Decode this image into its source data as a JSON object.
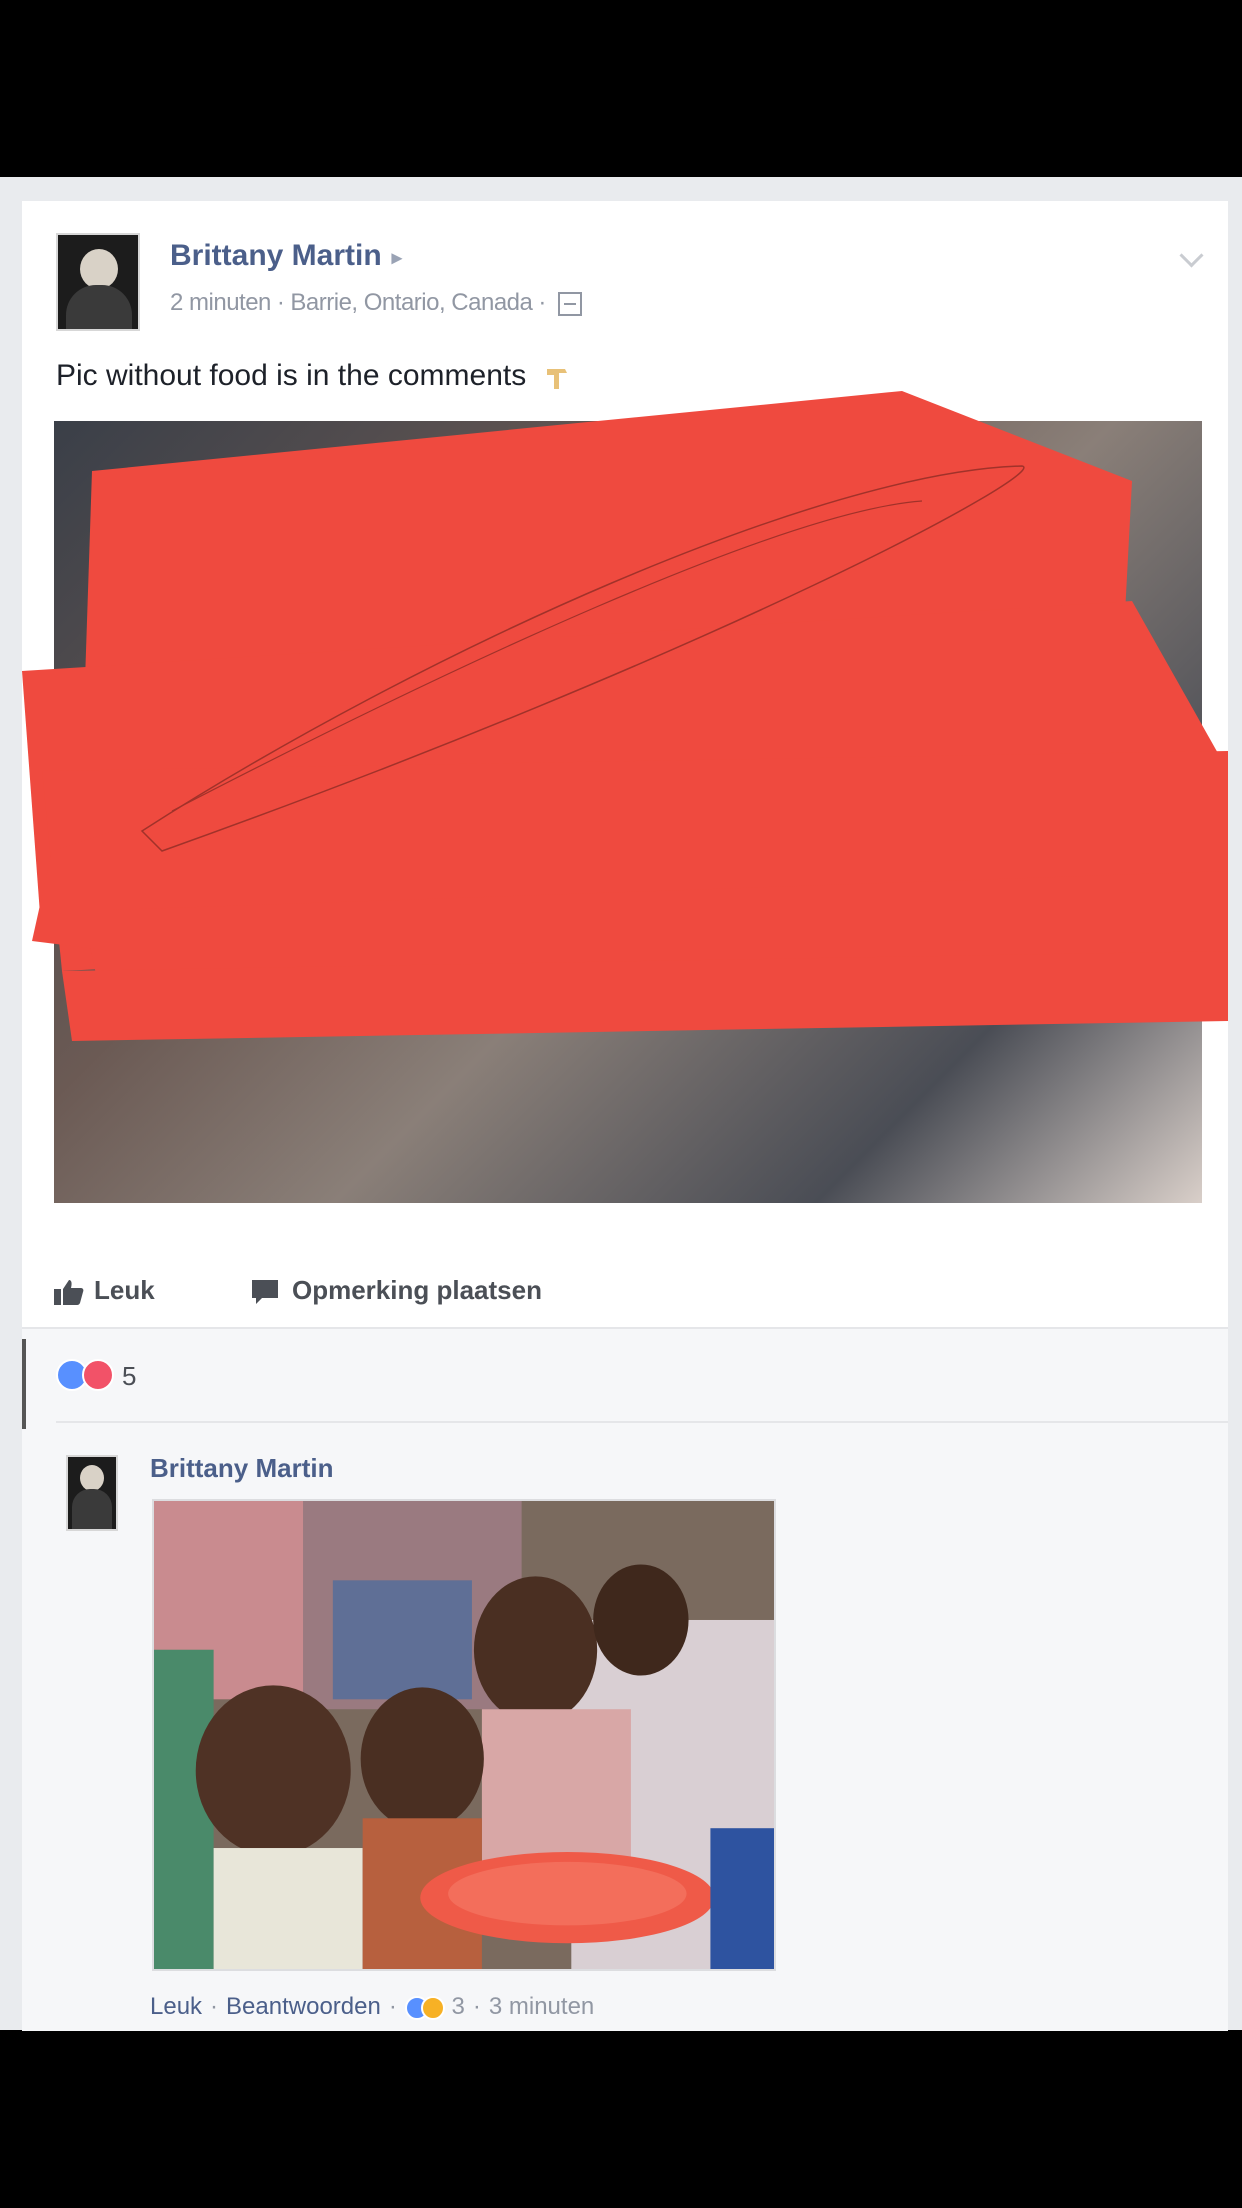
{
  "post": {
    "author": "Brittany Martin",
    "time": "2 minuten",
    "location": "Barrie, Ontario, Canada",
    "text": "Pic without food is in the comments"
  },
  "actions": {
    "like_label": "Leuk",
    "comment_label": "Opmerking plaatsen"
  },
  "reactions": {
    "count": "5"
  },
  "comment": {
    "author": "Brittany Martin",
    "like_label": "Leuk",
    "reply_label": "Beantwoorden",
    "reaction_count": "3",
    "time": "3 minuten"
  },
  "colors": {
    "link": "#4b5f8a",
    "meta": "#9197a3",
    "redaction": "#ef4a3f",
    "like": "#5890ff",
    "love": "#f25268"
  }
}
